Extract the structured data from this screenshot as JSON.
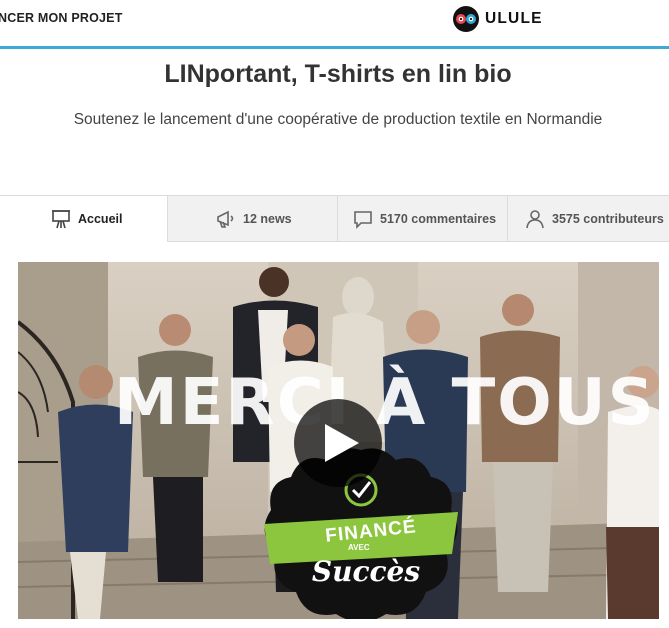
{
  "header": {
    "start_project_label": "NCER MON PROJET",
    "logo_text": "ULULE",
    "accent_color": "#3ea8d6"
  },
  "project": {
    "title": "LINportant, T-shirts en lin bio",
    "subtitle": "Soutenez le lancement d'une coopérative de production textile en Normandie"
  },
  "tabs": [
    {
      "label": "Accueil",
      "icon": "easel-icon",
      "active": true
    },
    {
      "label": "12 news",
      "icon": "megaphone-icon",
      "active": false
    },
    {
      "label": "5170 commentaires",
      "icon": "speech-bubble-icon",
      "active": false
    },
    {
      "label": "3575 contributeurs",
      "icon": "person-icon",
      "active": false
    }
  ],
  "video": {
    "overlay_text": "MERCI À TOUS",
    "badge_line1": "FINANCÉ",
    "badge_line2": "AVEC",
    "badge_line3": "Succès",
    "badge_green": "#8cc63f"
  }
}
